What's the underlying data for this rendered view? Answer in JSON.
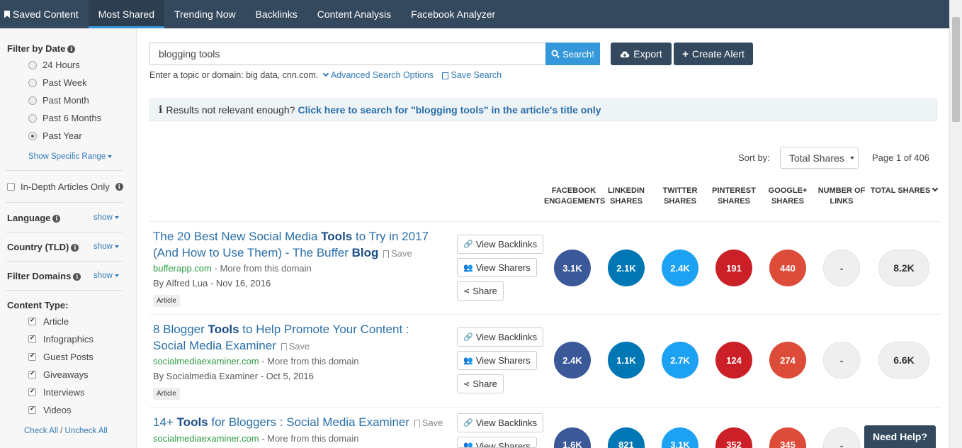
{
  "nav": {
    "tabs": [
      {
        "label": "Saved Content"
      },
      {
        "label": "Most Shared"
      },
      {
        "label": "Trending Now"
      },
      {
        "label": "Backlinks"
      },
      {
        "label": "Content Analysis"
      },
      {
        "label": "Facebook Analyzer"
      }
    ],
    "active_tab": "Most Shared"
  },
  "sidebar": {
    "filter_by_date": {
      "title": "Filter by Date",
      "options": [
        "24 Hours",
        "Past Week",
        "Past Month",
        "Past 6 Months",
        "Past Year"
      ],
      "selected": "Past Year",
      "show_range": "Show Specific Range"
    },
    "in_depth": "In-Depth Articles Only",
    "language": {
      "title": "Language",
      "toggle": "show"
    },
    "country": {
      "title": "Country (TLD)",
      "toggle": "show"
    },
    "filter_domains": {
      "title": "Filter Domains",
      "toggle": "show"
    },
    "content_type": {
      "title": "Content Type:",
      "options": [
        "Article",
        "Infographics",
        "Guest Posts",
        "Giveaways",
        "Interviews",
        "Videos"
      ],
      "checked": [
        true,
        true,
        true,
        true,
        true,
        true
      ]
    },
    "check_all": "Check All",
    "separator": "/",
    "uncheck_all": "Uncheck All"
  },
  "search": {
    "value": "blogging tools",
    "button": "Search!",
    "export": "Export",
    "create_alert": "Create Alert",
    "hint": "Enter a topic or domain: big data, cnn.com.",
    "advanced": "Advanced Search Options",
    "save_search": "Save Search"
  },
  "notice": {
    "text": "Results not relevant enough?",
    "link": "Click here to search for \"blogging tools\" in the article's title only"
  },
  "sort": {
    "label": "Sort by:",
    "value": "Total Shares",
    "page_info": "Page 1 of 406"
  },
  "columns": [
    [
      "FACEBOOK",
      "ENGAGEMENTS"
    ],
    [
      "LINKEDIN",
      "SHARES"
    ],
    [
      "TWITTER",
      "SHARES"
    ],
    [
      "PINTEREST",
      "SHARES"
    ],
    [
      "GOOGLE+",
      "SHARES"
    ],
    [
      "NUMBER OF",
      "LINKS"
    ],
    [
      "TOTAL SHARES",
      ""
    ]
  ],
  "colors": {
    "facebook": "#3b5998",
    "linkedin": "#0077b5",
    "twitter": "#1da1f2",
    "pinterest": "#cb2027",
    "googleplus": "#dd4b39",
    "nav_bg": "#34495e",
    "search_btn": "#3498db"
  },
  "actions": {
    "view_backlinks": "View Backlinks",
    "view_sharers": "View Sharers",
    "share": "Share",
    "save": "Save",
    "more_from": "- More from this domain"
  },
  "results": [
    {
      "title_parts": [
        "The 20 Best New Social Media ",
        "Tools",
        " to Try in 2017 (And How to Use Them) - The Buffer ",
        "Blog"
      ],
      "domain": "bufferapp.com",
      "byline": "By Alfred Lua - Nov 16, 2016",
      "tag": "Article",
      "facebook": "3.1K",
      "linkedin": "2.1K",
      "twitter": "2.4K",
      "pinterest": "191",
      "googleplus": "440",
      "links": "-",
      "total": "8.2K"
    },
    {
      "title_parts": [
        "8 Blogger ",
        "Tools",
        " to Help Promote Your Content : Social Media Examiner",
        ""
      ],
      "domain": "socialmediaexaminer.com",
      "byline": "By Socialmedia Examiner - Oct 5, 2016",
      "tag": "Article",
      "facebook": "2.4K",
      "linkedin": "1.1K",
      "twitter": "2.7K",
      "pinterest": "124",
      "googleplus": "274",
      "links": "-",
      "total": "6.6K"
    },
    {
      "title_parts": [
        "14+ ",
        "Tools",
        " for Bloggers : Social Media Examiner",
        ""
      ],
      "domain": "socialmediaexaminer.com",
      "facebook": "1.6K",
      "linkedin": "821",
      "twitter": "3.1K",
      "pinterest": "352",
      "googleplus": "345",
      "links": "-"
    }
  ],
  "help": "Need Help?"
}
